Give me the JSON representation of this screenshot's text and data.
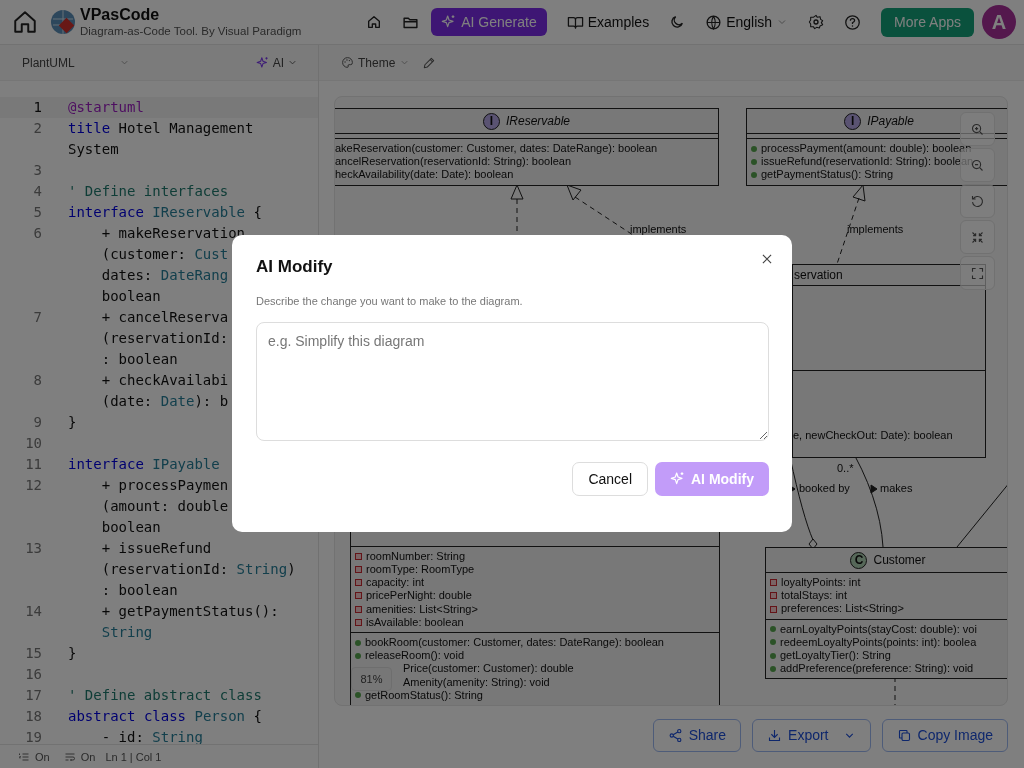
{
  "header": {
    "title": "VPasCode",
    "subtitle": "Diagram-as-Code Tool. By Visual Paradigm",
    "ai_generate": "AI Generate",
    "examples": "Examples",
    "language": "English",
    "more_apps": "More Apps",
    "avatar": "A"
  },
  "editor": {
    "language_select": "PlantUML",
    "ai_menu": "AI",
    "lines": [
      {
        "number": "1",
        "active": true,
        "rows": [
          [
            {
              "text": "@startuml",
              "kind": "directive"
            }
          ]
        ]
      },
      {
        "number": "2",
        "active": false,
        "rows": [
          [
            {
              "text": "title",
              "kind": "keyword"
            },
            {
              "text": " Hotel Management",
              "kind": "plain"
            }
          ],
          [
            {
              "text": "System",
              "kind": "plain"
            }
          ]
        ]
      },
      {
        "number": "3",
        "active": false
      },
      {
        "number": "4",
        "active": false,
        "rows": [
          [
            {
              "text": "' Define interfaces",
              "kind": "comment"
            }
          ]
        ]
      },
      {
        "number": "5",
        "active": false,
        "rows": [
          [
            {
              "text": "interface",
              "kind": "keyword"
            },
            {
              "text": " ",
              "kind": "plain"
            },
            {
              "text": "IReservable",
              "kind": "type"
            },
            {
              "text": " {",
              "kind": "plain"
            }
          ]
        ]
      },
      {
        "number": "6",
        "active": false,
        "rows": [
          [
            {
              "text": "    + makeReservation",
              "kind": "plain"
            }
          ],
          [
            {
              "text": "(customer: ",
              "kind": "plain"
            },
            {
              "text": "Cust",
              "kind": "type"
            }
          ],
          [
            {
              "text": "dates: ",
              "kind": "plain"
            },
            {
              "text": "DateRang",
              "kind": "type"
            }
          ],
          [
            {
              "text": "boolean",
              "kind": "plain"
            }
          ]
        ]
      },
      {
        "number": "7",
        "active": false,
        "rows": [
          [
            {
              "text": "    + cancelReserva",
              "kind": "plain"
            }
          ],
          [
            {
              "text": "(reservationId:",
              "kind": "plain"
            }
          ],
          [
            {
              "text": ": boolean",
              "kind": "plain"
            }
          ]
        ]
      },
      {
        "number": "8",
        "active": false,
        "rows": [
          [
            {
              "text": "    + checkAvailabi",
              "kind": "plain"
            }
          ],
          [
            {
              "text": "(date: ",
              "kind": "plain"
            },
            {
              "text": "Date",
              "kind": "type"
            },
            {
              "text": "): b",
              "kind": "plain"
            }
          ]
        ]
      },
      {
        "number": "9",
        "active": false,
        "rows": [
          [
            {
              "text": "}",
              "kind": "plain"
            }
          ]
        ]
      },
      {
        "number": "10",
        "active": false
      },
      {
        "number": "11",
        "active": false,
        "rows": [
          [
            {
              "text": "interface",
              "kind": "keyword"
            },
            {
              "text": " ",
              "kind": "plain"
            },
            {
              "text": "IPayable",
              "kind": "type"
            }
          ]
        ]
      },
      {
        "number": "12",
        "active": false,
        "rows": [
          [
            {
              "text": "    + processPaymen",
              "kind": "plain"
            }
          ],
          [
            {
              "text": "(amount: double",
              "kind": "plain"
            }
          ],
          [
            {
              "text": "boolean",
              "kind": "plain"
            }
          ]
        ]
      },
      {
        "number": "13",
        "active": false,
        "rows": [
          [
            {
              "text": "    + issueRefund",
              "kind": "plain"
            }
          ],
          [
            {
              "text": "(reservationId: ",
              "kind": "plain"
            },
            {
              "text": "String",
              "kind": "type"
            },
            {
              "text": ")",
              "kind": "plain"
            }
          ],
          [
            {
              "text": ": boolean",
              "kind": "plain"
            }
          ]
        ]
      },
      {
        "number": "14",
        "active": false,
        "rows": [
          [
            {
              "text": "    + getPaymentStatus():",
              "kind": "plain"
            }
          ],
          [
            {
              "text": "String",
              "kind": "type"
            }
          ]
        ]
      },
      {
        "number": "15",
        "active": false,
        "rows": [
          [
            {
              "text": "}",
              "kind": "plain"
            }
          ]
        ]
      },
      {
        "number": "16",
        "active": false
      },
      {
        "number": "17",
        "active": false,
        "rows": [
          [
            {
              "text": "' Define abstract class",
              "kind": "comment"
            }
          ]
        ]
      },
      {
        "number": "18",
        "active": false,
        "rows": [
          [
            {
              "text": "abstract",
              "kind": "keyword"
            },
            {
              "text": " ",
              "kind": "plain"
            },
            {
              "text": "class",
              "kind": "keyword"
            },
            {
              "text": " ",
              "kind": "plain"
            },
            {
              "text": "Person",
              "kind": "type"
            },
            {
              "text": " {",
              "kind": "plain"
            }
          ]
        ]
      },
      {
        "number": "19",
        "active": false,
        "rows": [
          [
            {
              "text": "    - id: ",
              "kind": "plain"
            },
            {
              "text": "String",
              "kind": "type"
            }
          ]
        ]
      }
    ],
    "status": [
      {
        "text": "On",
        "kind": "line-numbers"
      },
      {
        "text": "On",
        "kind": "wrap"
      }
    ],
    "position": "Ln 1 | Col 1"
  },
  "preview": {
    "theme_menu": "Theme",
    "zoom_level": "81%",
    "classes": [
      {
        "kind": "interface",
        "badge": "I",
        "title": "IReservable",
        "methods": [
          {
            "text": "akeReservation(customer: Customer, dates: DateRange): boolean"
          },
          {
            "text": "ancelReservation(reservationId: String): boolean"
          },
          {
            "text": "heckAvailability(date: Date): boolean"
          }
        ]
      },
      {
        "kind": "interface",
        "badge": "I",
        "title": "IPayable",
        "methods": [
          {
            "text": "processPayment(amount: double): boolean",
            "public": true
          },
          {
            "text": "issueRefund(reservationId: String): boolean",
            "public": true
          },
          {
            "text": "getPaymentStatus(): String",
            "public": true
          }
        ]
      },
      {
        "kind": "cut",
        "title": "servation",
        "methods": [
          {
            "text": "e, newCheckOut: Date): boolean"
          }
        ]
      },
      {
        "kind": "cut",
        "fields": [
          {
            "text": "roomNumber: String",
            "public": false
          },
          {
            "text": "roomType: RoomType",
            "public": false
          },
          {
            "text": "capacity: int",
            "public": false
          },
          {
            "text": "pricePerNight: double",
            "public": false
          },
          {
            "text": "amenities: List<String>",
            "public": false
          },
          {
            "text": "isAvailable: boolean",
            "public": false
          }
        ],
        "methods": [
          {
            "text": "bookRoom(customer: Customer, dates: DateRange): boolean",
            "public": true
          },
          {
            "text": "releaseRoom(): void",
            "public": true
          },
          {
            "text": "Price(customer: Customer): double"
          },
          {
            "text": "Amenity(amenity: String): void"
          },
          {
            "text": "getRoomStatus(): String",
            "public": true
          }
        ]
      },
      {
        "kind": "class",
        "badge": "C",
        "title": "Customer",
        "fields": [
          {
            "text": "loyaltyPoints: int",
            "public": false
          },
          {
            "text": "totalStays: int",
            "public": false
          },
          {
            "text": "preferences: List<String>",
            "public": false
          }
        ],
        "methods": [
          {
            "text": "earnLoyaltyPoints(stayCost: double): voi",
            "public": true
          },
          {
            "text": "redeemLoyaltyPoints(points: int): boolea",
            "public": true
          },
          {
            "text": "getLoyaltyTier(): String",
            "public": true
          },
          {
            "text": "addPreference(preference: String): void",
            "public": true
          }
        ]
      }
    ],
    "labels": [
      "implements",
      "implements",
      "0..*",
      "booked by",
      "makes"
    ],
    "actions": [
      {
        "label": "Share",
        "kind": "share"
      },
      {
        "label": "Export",
        "kind": "export"
      },
      {
        "label": "Copy Image",
        "kind": "copy"
      }
    ]
  },
  "modal": {
    "title": "AI Modify",
    "description": "Describe the change you want to make to the diagram.",
    "placeholder": "e.g. Simplify this diagram",
    "buttons": [
      {
        "label": "Cancel",
        "kind": "secondary",
        "disabled": false
      },
      {
        "label": "AI Modify",
        "kind": "primary",
        "disabled": true
      }
    ]
  }
}
